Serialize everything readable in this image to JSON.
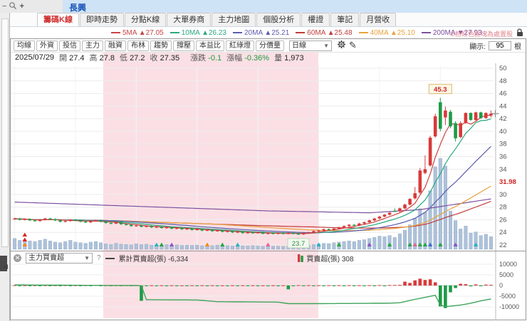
{
  "window": {
    "title": "長興",
    "zoom_minus": "−",
    "zoom_plus": "+"
  },
  "tabs": {
    "items": [
      {
        "label": "籌碼K線",
        "active": true
      },
      {
        "label": "即時走勢",
        "active": false
      },
      {
        "label": "分點K線",
        "active": false
      },
      {
        "label": "大單券商",
        "active": false
      },
      {
        "label": "主力地圖",
        "active": false
      },
      {
        "label": "個股分析",
        "active": false
      },
      {
        "label": "權證",
        "active": false
      },
      {
        "label": "筆記",
        "active": false
      },
      {
        "label": "月營收",
        "active": false
      }
    ]
  },
  "ma_legend": {
    "items": [
      {
        "name": "5MA",
        "arrow": "▲",
        "value": "27.05",
        "color": "#c94444"
      },
      {
        "name": "10MA",
        "arrow": "▲",
        "value": "26.23",
        "color": "#2aa882"
      },
      {
        "name": "20MA",
        "arrow": "▲",
        "value": "25.21",
        "color": "#5c5cb0"
      },
      {
        "name": "60MA",
        "arrow": "▲",
        "value": "25.48",
        "color": "#c23b3b"
      },
      {
        "name": "40MA",
        "arrow": "▲",
        "value": "25.10",
        "color": "#e8a33d"
      },
      {
        "name": "200MA",
        "arrow": "▼",
        "value": "27.93",
        "color": "#7d4f9e"
      }
    ],
    "note": "①粉紅色區塊為處置股"
  },
  "toolbar": {
    "buttons": [
      "均線",
      "外資",
      "投信",
      "主力",
      "融資",
      "布林",
      "趨勢",
      "撐壓",
      "本益比",
      "紅綠燈",
      "分價量"
    ],
    "period": "日線",
    "display_label": "顯示:",
    "bar_count": "95",
    "bar_unit": "根"
  },
  "info": {
    "date": "2025/07/29",
    "open_label": "開",
    "open": "27.4",
    "high_label": "高",
    "high": "27.8",
    "low_label": "低",
    "low": "27.2",
    "close_label": "收",
    "close": "27.35",
    "chg_label": "漲跌",
    "chg": "-0.1",
    "chg_pct_label": "漲幅",
    "chg_pct": "-0.36%",
    "vol_label": "量",
    "vol": "1,973"
  },
  "lower_header": {
    "dropdown": "主力買賣超",
    "help": "?",
    "line_legend": "累計買賣超(張)",
    "line_value": "-6,334",
    "bar_legend": "買賣超(張)",
    "bar_value": "308"
  },
  "chart_data": {
    "type": "candlestick",
    "bars_shown": 95,
    "y_axis": {
      "min": 22,
      "max": 50,
      "ticks": [
        50,
        48,
        46,
        44,
        42,
        40,
        38,
        36,
        34,
        32,
        30,
        28,
        26,
        24,
        22
      ],
      "special_tick": {
        "value": 32,
        "label": "31.98",
        "color": "#cc2222"
      }
    },
    "high_annotation": {
      "index": 84,
      "price": 45.3,
      "label": "45.3"
    },
    "low_annotation": {
      "index": 56,
      "price": 23.7,
      "label": "23.7"
    },
    "pink_zone": {
      "start_index": 18,
      "end_index": 60
    },
    "up_color": "#d83a3a",
    "down_color": "#1e9b47",
    "volume_color": "#adc2da",
    "closes": [
      26.2,
      26.0,
      26.1,
      25.9,
      25.8,
      26.0,
      26.2,
      26.1,
      25.9,
      25.7,
      25.8,
      26.0,
      25.9,
      25.7,
      25.6,
      25.8,
      25.9,
      25.7,
      25.5,
      25.4,
      25.6,
      25.3,
      25.2,
      25.0,
      25.1,
      24.9,
      25.0,
      24.8,
      24.9,
      24.7,
      24.8,
      24.6,
      24.7,
      24.5,
      24.6,
      24.4,
      24.5,
      24.3,
      24.4,
      24.2,
      24.3,
      24.1,
      24.2,
      24.0,
      24.1,
      23.9,
      24.0,
      23.9,
      24.0,
      23.8,
      23.9,
      23.8,
      23.9,
      23.8,
      23.9,
      23.8,
      23.7,
      23.9,
      24.0,
      24.2,
      24.3,
      24.5,
      24.4,
      24.6,
      24.8,
      25.0,
      25.2,
      25.1,
      25.4,
      25.6,
      25.9,
      26.2,
      26.5,
      26.8,
      27.1,
      27.35,
      27.8,
      28.4,
      29.3,
      30.2,
      33.8,
      34.0,
      39.0,
      42.4,
      40.4,
      43.3,
      40.8,
      38.9,
      41.3,
      42.9,
      41.8,
      43.0,
      42.1,
      42.9,
      42.8
    ],
    "candle_overrides": {
      "75": {
        "o": 27.4,
        "h": 27.8,
        "l": 27.2,
        "c": 27.35
      },
      "79": {
        "o": 29.4,
        "h": 31.2,
        "l": 29.2,
        "c": 30.2
      },
      "80": {
        "o": 30.3,
        "h": 34.2,
        "l": 30.1,
        "c": 33.8
      },
      "81": {
        "o": 33.4,
        "h": 36.2,
        "l": 33.2,
        "c": 34.0
      },
      "82": {
        "o": 34.6,
        "h": 39.3,
        "l": 34.4,
        "c": 39.0
      },
      "83": {
        "o": 39.2,
        "h": 42.8,
        "l": 39.0,
        "c": 42.4
      },
      "84": {
        "o": 44.6,
        "h": 45.3,
        "l": 40.0,
        "c": 40.4
      },
      "85": {
        "o": 42.2,
        "h": 43.9,
        "l": 41.0,
        "c": 43.3
      },
      "86": {
        "o": 43.1,
        "h": 43.4,
        "l": 40.5,
        "c": 40.8
      },
      "87": {
        "o": 41.3,
        "h": 41.6,
        "l": 38.4,
        "c": 38.9
      },
      "88": {
        "o": 39.1,
        "h": 41.6,
        "l": 38.9,
        "c": 41.3
      },
      "94": {
        "o": 42.5,
        "h": 43.3,
        "l": 42.2,
        "c": 42.8
      }
    },
    "volumes": [
      1800,
      1500,
      1600,
      1400,
      1300,
      1500,
      1700,
      1400,
      1200,
      1100,
      1300,
      1500,
      1200,
      1100,
      1000,
      1200,
      1300,
      1100,
      900,
      800,
      1000,
      850,
      800,
      750,
      900,
      800,
      850,
      700,
      750,
      700,
      800,
      700,
      750,
      650,
      700,
      650,
      700,
      600,
      650,
      600,
      700,
      650,
      600,
      550,
      600,
      580,
      560,
      600,
      550,
      520,
      560,
      540,
      520,
      500,
      520,
      540,
      560,
      600,
      700,
      800,
      900,
      1000,
      950,
      1100,
      1200,
      1300,
      1400,
      1300,
      1500,
      1600,
      1800,
      2000,
      2200,
      2100,
      2300,
      1973,
      2600,
      3200,
      4100,
      5200,
      6800,
      6200,
      9800,
      13800,
      15200,
      13900,
      6400,
      4800,
      3400,
      3900,
      2700,
      2900,
      2300,
      2500,
      2100
    ],
    "ma200_points": [
      [
        0,
        28.8
      ],
      [
        25,
        28.1
      ],
      [
        50,
        27.4
      ],
      [
        70,
        27.1
      ],
      [
        80,
        27.6
      ],
      [
        94,
        29.3
      ]
    ],
    "markers": [
      {
        "i": 2,
        "colors": [
          "#dd2222",
          "#dd2222",
          "#f08a1d"
        ]
      },
      {
        "i": 28,
        "colors": [
          "#2bb3c0"
        ]
      },
      {
        "i": 29,
        "colors": [
          "#28a745"
        ]
      },
      {
        "i": 31,
        "colors": [
          "#8a57c9"
        ]
      },
      {
        "i": 38,
        "colors": [
          "#f08a1d"
        ]
      },
      {
        "i": 41,
        "colors": [
          "#28a745"
        ]
      },
      {
        "i": 44,
        "colors": [
          "#2bb3c0"
        ]
      },
      {
        "i": 50,
        "colors": [
          "#e8629a"
        ]
      },
      {
        "i": 56,
        "colors": [
          "#28a745",
          "#f08a1d"
        ]
      },
      {
        "i": 60,
        "colors": [
          "#2bb3c0"
        ]
      },
      {
        "i": 64,
        "colors": [
          "#28a745"
        ]
      },
      {
        "i": 70,
        "colors": [
          "#8a57c9"
        ]
      },
      {
        "i": 74,
        "colors": [
          "#28a745"
        ]
      },
      {
        "i": 78,
        "colors": [
          "#28a745"
        ]
      },
      {
        "i": 79,
        "colors": [
          "#e8629a"
        ]
      },
      {
        "i": 80,
        "colors": [
          "#28a745"
        ]
      },
      {
        "i": 81,
        "colors": [
          "#28a745"
        ]
      },
      {
        "i": 82,
        "colors": [
          "#3a6fd8"
        ]
      },
      {
        "i": 84,
        "colors": [
          "#28a745"
        ]
      },
      {
        "i": 87,
        "colors": [
          "#8a57c9"
        ]
      },
      {
        "i": 91,
        "colors": [
          "#2bb3c0"
        ]
      }
    ],
    "lower": {
      "type": "bar+line",
      "y_ticks": [
        10000,
        5000,
        0,
        -5000,
        -10000
      ],
      "line_color": "#3fa45b",
      "bars": [
        120,
        -80,
        60,
        -100,
        90,
        -60,
        110,
        -90,
        70,
        -120,
        100,
        -70,
        80,
        -110,
        60,
        -90,
        120,
        -60,
        80,
        -100,
        70,
        -90,
        110,
        -80,
        90,
        -7200,
        -150,
        80,
        -120,
        60,
        -100,
        70,
        -130,
        50,
        -90,
        80,
        -110,
        60,
        -140,
        70,
        -100,
        50,
        -120,
        80,
        -90,
        60,
        -110,
        70,
        -100,
        50,
        -130,
        60,
        -90,
        70,
        -1800,
        -200,
        150,
        -100,
        120,
        -80,
        100,
        -60,
        140,
        -90,
        110,
        -70,
        130,
        -80,
        100,
        -60,
        120,
        -90,
        150,
        -100,
        200,
        250,
        300,
        1800,
        1200,
        2400,
        3200,
        2600,
        2900,
        1500,
        -9800,
        -10600,
        -3200,
        -1200,
        800,
        600,
        -400,
        500,
        -300,
        400,
        308
      ],
      "line_points": [
        [
          0,
          300
        ],
        [
          12,
          100
        ],
        [
          24,
          0
        ],
        [
          25,
          -100
        ],
        [
          26,
          -6700
        ],
        [
          36,
          -6800
        ],
        [
          40,
          -7600
        ],
        [
          46,
          -7700
        ],
        [
          52,
          -7800
        ],
        [
          54,
          -8500
        ],
        [
          60,
          -8500
        ],
        [
          68,
          -8400
        ],
        [
          74,
          -8300
        ],
        [
          76,
          -8100
        ],
        [
          79,
          -6500
        ],
        [
          83,
          -4600
        ],
        [
          84,
          -9200
        ],
        [
          85,
          -9900
        ],
        [
          86,
          -9700
        ],
        [
          88,
          -9200
        ],
        [
          90,
          -8300
        ],
        [
          92,
          -7200
        ],
        [
          94,
          -6334
        ]
      ]
    }
  }
}
